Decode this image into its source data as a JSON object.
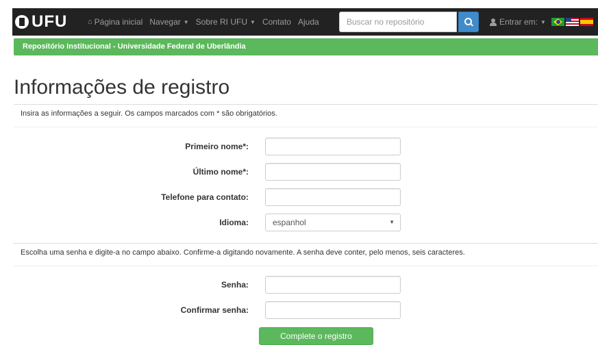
{
  "navbar": {
    "brand": "UFU",
    "links": [
      {
        "label": "Página inicial",
        "icon": "home-icon"
      },
      {
        "label": "Navegar",
        "dropdown": true
      },
      {
        "label": "Sobre RI UFU",
        "dropdown": true
      },
      {
        "label": "Contato"
      },
      {
        "label": "Ajuda"
      }
    ],
    "search_placeholder": "Buscar no repositório",
    "login_label": "Entrar em:",
    "flags": [
      "brazil-flag-icon",
      "usa-flag-icon",
      "spain-flag-icon"
    ]
  },
  "banner": "Repositório Institucional - Universidade Federal de Uberlândia",
  "page": {
    "title": "Informações de registro",
    "intro": "Insira as informações a seguir. Os campos marcados com * são obrigatórios.",
    "fields": {
      "first_name": {
        "label": "Primeiro nome*:",
        "value": ""
      },
      "last_name": {
        "label": "Último nome*:",
        "value": ""
      },
      "phone": {
        "label": "Telefone para contato:",
        "value": ""
      },
      "language": {
        "label": "Idioma:",
        "value": "espanhol"
      }
    },
    "password_note": "Escolha uma senha e digite-a no campo abaixo. Confirme-a digitando novamente. A senha deve conter, pelo menos, seis caracteres.",
    "password": {
      "label": "Senha:",
      "value": ""
    },
    "confirm_password": {
      "label": "Confirmar senha:",
      "value": ""
    },
    "submit_label": "Complete o registro"
  },
  "colors": {
    "navbar_bg": "#222222",
    "banner_green": "#5cb85c",
    "search_blue": "#428bca"
  }
}
